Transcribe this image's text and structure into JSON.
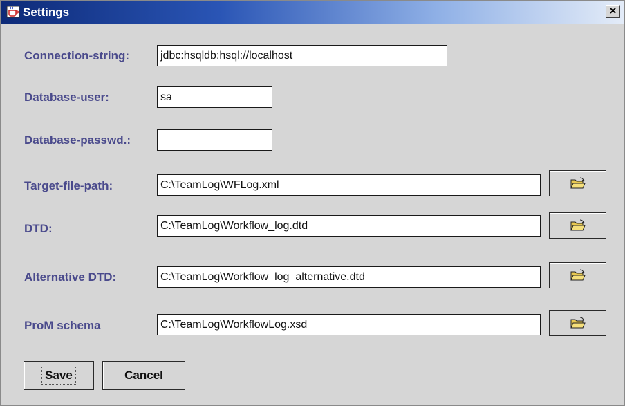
{
  "window": {
    "title": "Settings",
    "close_symbol": "×"
  },
  "fields": {
    "connection": {
      "label": "Connection-string:",
      "value": "jdbc:hsqldb:hsql://localhost"
    },
    "user": {
      "label": "Database-user:",
      "value": "sa"
    },
    "password": {
      "label": "Database-passwd.:",
      "value": ""
    },
    "target": {
      "label": "Target-file-path:",
      "value": "C:\\TeamLog\\WFLog.xml"
    },
    "dtd": {
      "label": "DTD:",
      "value": "C:\\TeamLog\\Workflow_log.dtd"
    },
    "alt_dtd": {
      "label": "Alternative DTD:",
      "value": "C:\\TeamLog\\Workflow_log_alternative.dtd"
    },
    "prom": {
      "label": "ProM schema",
      "value": "C:\\TeamLog\\WorkflowLog.xsd"
    }
  },
  "buttons": {
    "save": "Save",
    "cancel": "Cancel"
  },
  "icons": {
    "browse": "open-folder-icon",
    "app": "java-cup-icon",
    "close": "close-icon"
  },
  "colors": {
    "label": "#4a4a8c",
    "title_start": "#0d2a78",
    "title_end": "#e4ecf8",
    "background": "#d6d6d6"
  }
}
